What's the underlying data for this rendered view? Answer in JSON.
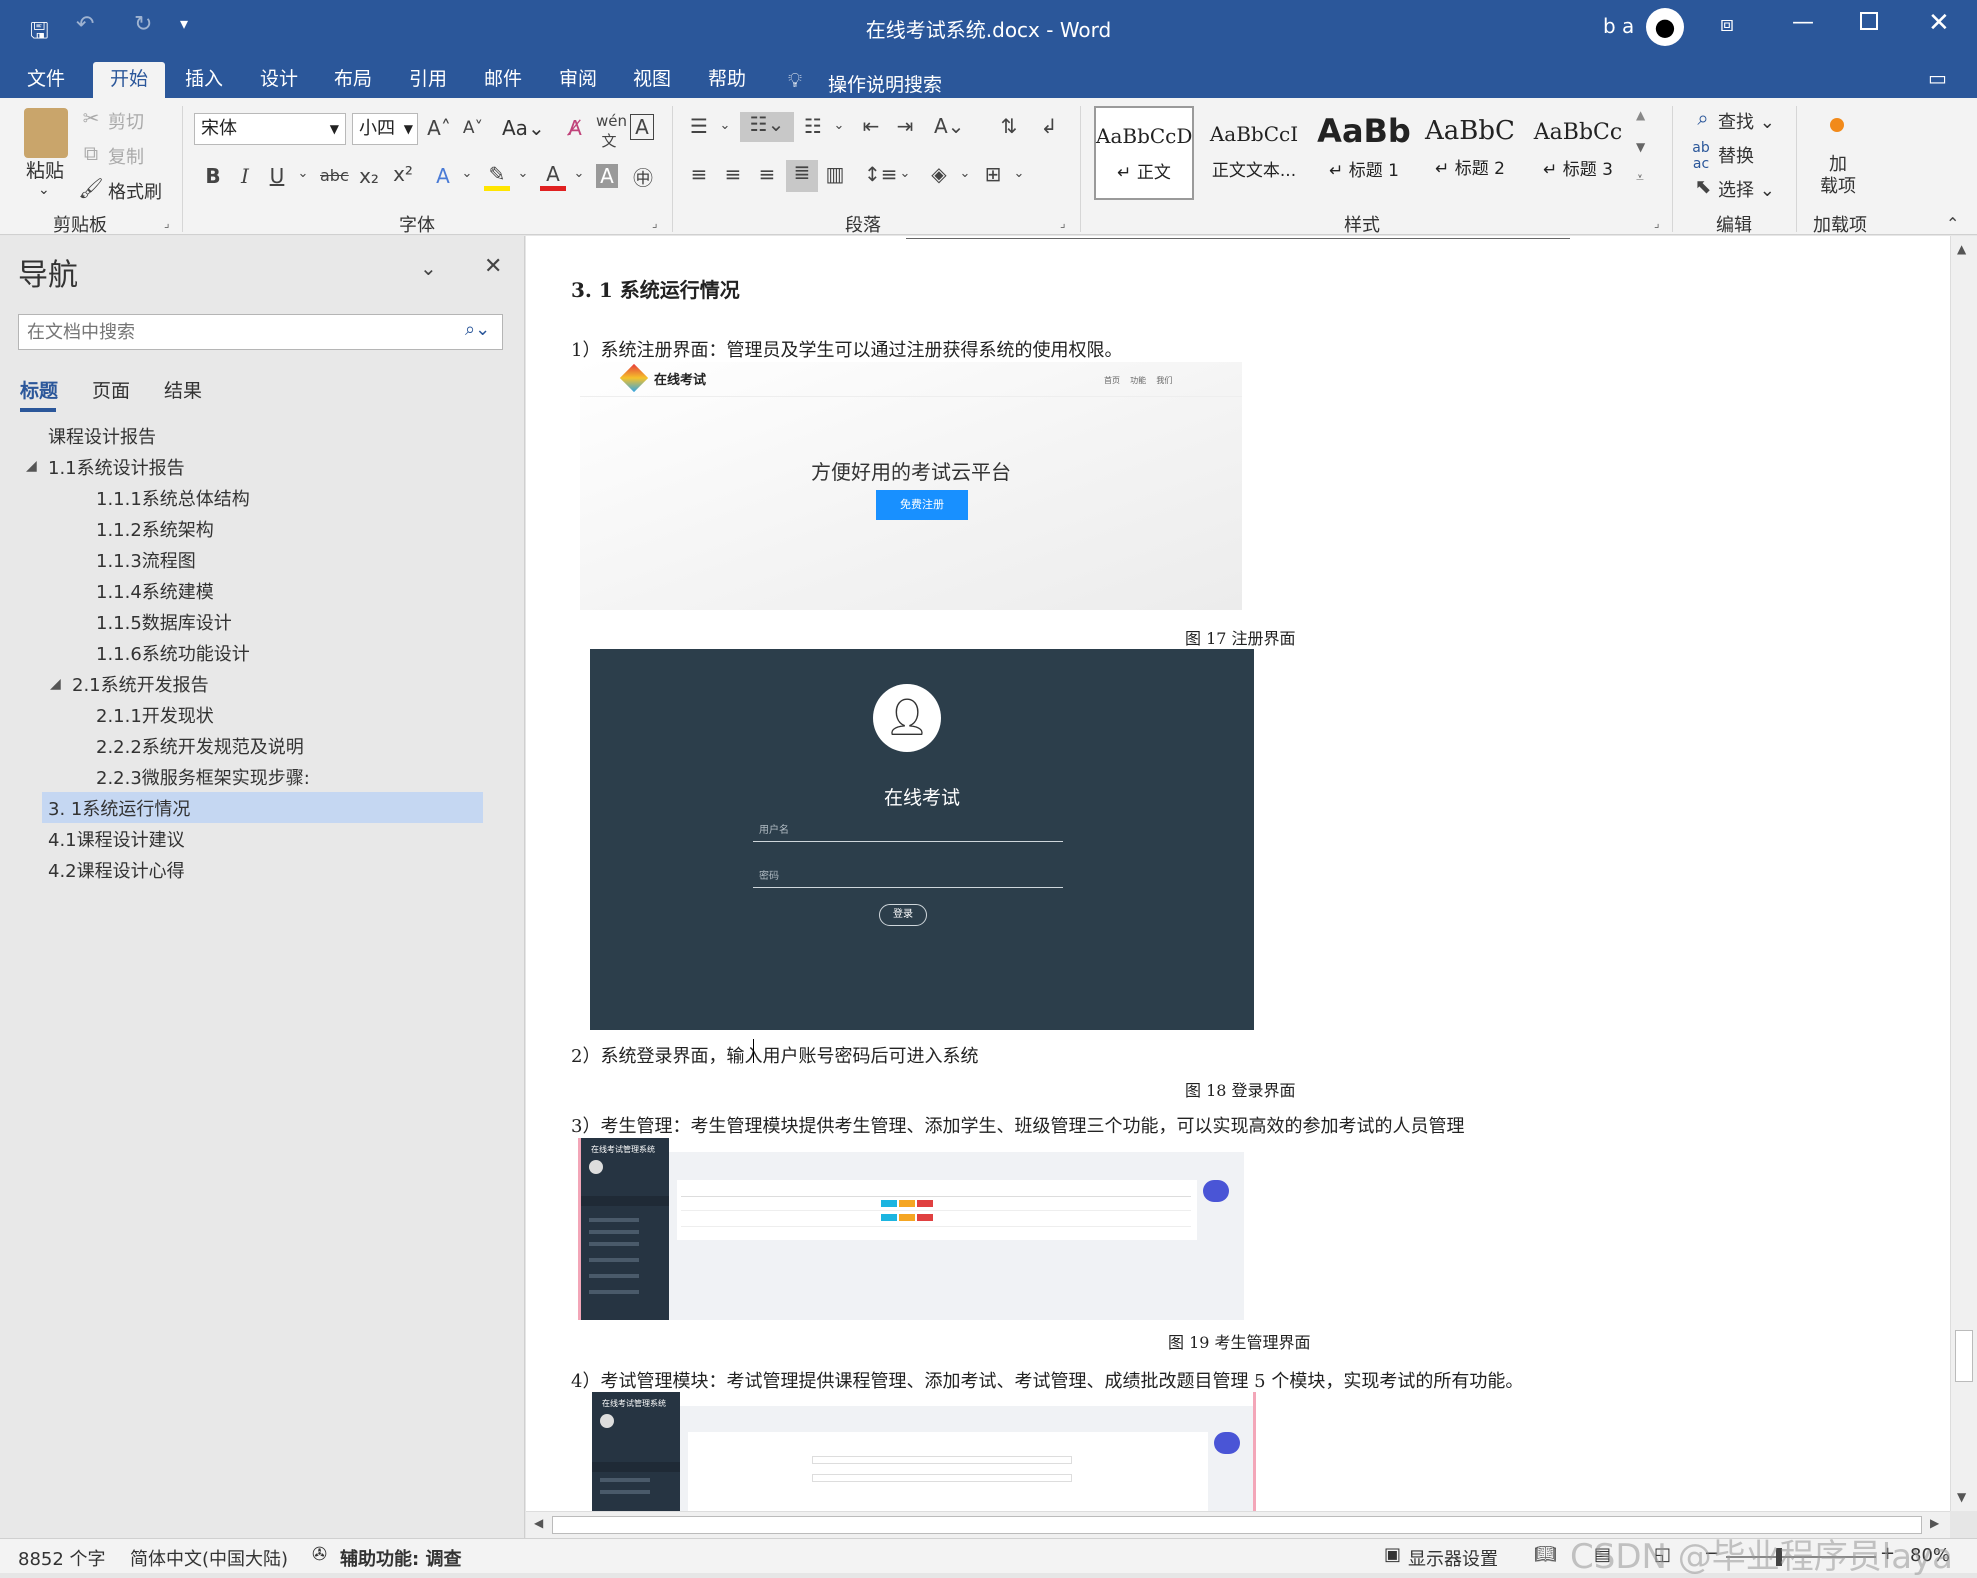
{
  "window": {
    "title": "在线考试系统.docx  -  Word",
    "user": "b a"
  },
  "tabs": [
    "文件",
    "开始",
    "插入",
    "设计",
    "布局",
    "引用",
    "邮件",
    "审阅",
    "视图",
    "帮助"
  ],
  "tell_me": "操作说明搜索",
  "ribbon": {
    "clipboard": {
      "paste": "粘贴",
      "cut": "剪切",
      "copy": "复制",
      "format_painter": "格式刷",
      "label": "剪贴板"
    },
    "font": {
      "name": "宋体",
      "size": "小四",
      "label": "字体",
      "case": "Aa"
    },
    "paragraph": {
      "label": "段落"
    },
    "styles": {
      "label": "样式",
      "items": [
        {
          "sample": "AaBbCcD",
          "name": "↵ 正文"
        },
        {
          "sample": "AaBbCcI",
          "name": "正文文本..."
        },
        {
          "sample": "AaBb",
          "name": "↵ 标题 1"
        },
        {
          "sample": "AaBbC",
          "name": "↵ 标题 2"
        },
        {
          "sample": "AaBbCc",
          "name": "↵ 标题 3"
        }
      ]
    },
    "editing": {
      "find": "查找",
      "replace": "替换",
      "select": "选择",
      "label": "编辑"
    },
    "addins": {
      "button": "加\n载项",
      "label": "加载项"
    }
  },
  "nav": {
    "title": "导航",
    "search_placeholder": "在文档中搜索",
    "tabs": [
      "标题",
      "页面",
      "结果"
    ],
    "items": [
      {
        "text": "课程设计报告",
        "level": 1
      },
      {
        "text": "1.1系统设计报告",
        "level": 1
      },
      {
        "text": "1.1.1系统总体结构",
        "level": 3
      },
      {
        "text": "1.1.2系统架构",
        "level": 3
      },
      {
        "text": "1.1.3流程图",
        "level": 3
      },
      {
        "text": "1.1.4系统建模",
        "level": 3
      },
      {
        "text": "1.1.5数据库设计",
        "level": 3
      },
      {
        "text": "1.1.6系统功能设计",
        "level": 3
      },
      {
        "text": "2.1系统开发报告",
        "level": 2
      },
      {
        "text": "2.1.1开发现状",
        "level": 3
      },
      {
        "text": "2.2.2系统开发规范及说明",
        "level": 3
      },
      {
        "text": "2.2.3微服务框架实现步骤:",
        "level": 3
      },
      {
        "text": "3. 1系统运行情况",
        "level": 1
      },
      {
        "text": "4.1课程设计建议",
        "level": 1
      },
      {
        "text": "4.2课程设计心得",
        "level": 1
      }
    ]
  },
  "doc": {
    "heading": "3. 1 系统运行情况",
    "p1": "1）系统注册界面：管理员及学生可以通过注册获得系统的使用权限。",
    "fig17": {
      "brand": "在线考试",
      "slogan": "方便好用的考试云平台",
      "button": "免费注册",
      "nav": "首页    功能    我们",
      "caption": "图 17 注册界面"
    },
    "fig18": {
      "title": "在线考试",
      "user_ph": "用户名",
      "pwd_ph": "密码",
      "button": "登录",
      "caption": "图 18 登录界面"
    },
    "p2": "2）系统登录界面，输入用户账号密码后可进入系统",
    "p3": "3）考生管理：考生管理模块提供考生管理、添加学生、班级管理三个功能，可以实现高效的参加考试的人员管理",
    "fig19": {
      "system": "在线考试管理系统",
      "caption": "图 19 考生管理界面"
    },
    "p4": "4）考试管理模块：考试管理提供课程管理、添加考试、考试管理、成绩批改题目管理 5 个模块，实现考试的所有功能。",
    "fig20": {
      "system": "在线考试管理系统"
    }
  },
  "status": {
    "words": "8852 个字",
    "lang": "简体中文(中国大陆)",
    "access": "辅助功能: 调查",
    "display": "显示器设置",
    "zoom": "80%",
    "watermark": "CSDN @毕业程序员laya"
  },
  "colors": {
    "brand": "#2b579a",
    "selected": "#c5d7f2",
    "login_bg": "#2c3e4b",
    "button_blue": "#1890ff"
  }
}
